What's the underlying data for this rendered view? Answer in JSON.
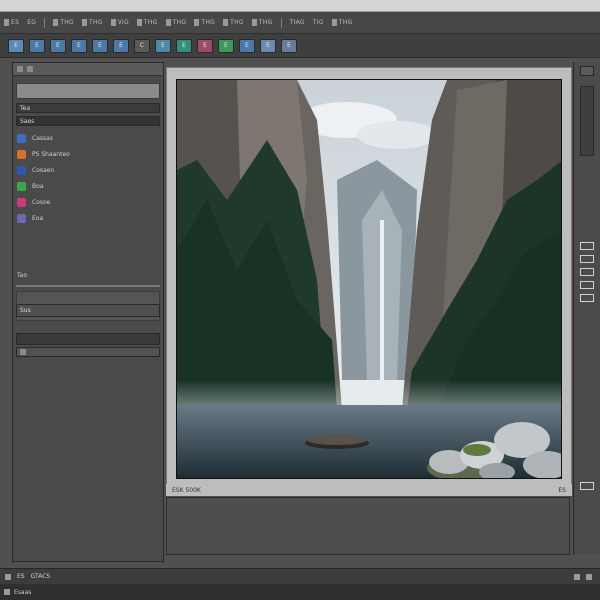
{
  "menu": {
    "items": [
      {
        "label": "ES",
        "icon": "document-icon"
      },
      {
        "label": "EG",
        "icon": "none"
      },
      {
        "label": "THG",
        "icon": "document-icon"
      },
      {
        "label": "THG",
        "icon": "document-icon"
      },
      {
        "label": "ViG",
        "icon": "document-icon"
      },
      {
        "label": "THG",
        "icon": "document-icon"
      },
      {
        "label": "THG",
        "icon": "document-icon"
      },
      {
        "label": "THG",
        "icon": "document-icon"
      },
      {
        "label": "THG",
        "icon": "document-icon"
      },
      {
        "label": "THG",
        "icon": "document-icon"
      },
      {
        "label": "TIAG",
        "icon": "none"
      },
      {
        "label": "TIG",
        "icon": "none"
      },
      {
        "label": "THG",
        "icon": "document-icon"
      }
    ]
  },
  "toolbar": {
    "buttons": [
      {
        "label": "E",
        "color": "#5a8ab8",
        "icon": "file-icon"
      },
      {
        "label": "E",
        "color": "#4c7aa8",
        "icon": "file-icon"
      },
      {
        "label": "E",
        "color": "#4c7aa8",
        "icon": "file-icon"
      },
      {
        "label": "E",
        "color": "#4c7aa8",
        "icon": "file-icon"
      },
      {
        "label": "E",
        "color": "#4c7aa8",
        "icon": "file-icon"
      },
      {
        "label": "E",
        "color": "#4c7aa8",
        "icon": "file-icon"
      },
      {
        "label": "C",
        "color": "#5a5a5a",
        "icon": "refresh-icon"
      },
      {
        "label": "E",
        "color": "#4c8aa8",
        "icon": "file-icon"
      },
      {
        "label": "E",
        "color": "#2e8f7a",
        "icon": "file-icon"
      },
      {
        "label": "E",
        "color": "#a04a6a",
        "icon": "file-icon"
      },
      {
        "label": "E",
        "color": "#3a9a5a",
        "icon": "file-icon"
      },
      {
        "label": "E",
        "color": "#4c7aa8",
        "icon": "file-icon"
      },
      {
        "label": "E",
        "color": "#6a8ab0",
        "icon": "file-icon"
      },
      {
        "label": "E",
        "color": "#6a7a9a",
        "icon": "file-icon"
      }
    ]
  },
  "left_panel": {
    "tab_label": "Tea",
    "bar_label": "Saes",
    "items": [
      {
        "label": "Cassas",
        "color": "#3a6ec8",
        "icon": "layer-icon"
      },
      {
        "label": "PS Shaanteo",
        "color": "#d8702a",
        "icon": "photoshop-icon"
      },
      {
        "label": "Cosaen",
        "color": "#2a5ab0",
        "icon": "layer-icon"
      },
      {
        "label": "Boa",
        "color": "#3aa84a",
        "icon": "leaf-icon"
      },
      {
        "label": "Cosoe",
        "color": "#c83a7a",
        "icon": "brush-icon"
      },
      {
        "label": "Eoa",
        "color": "#6a6ab0",
        "icon": "pen-icon"
      }
    ],
    "sub_label": "Tao",
    "bottom_label": "Sus"
  },
  "canvas": {
    "status_left": "ESK 500K",
    "status_right": "ES"
  },
  "bottom": {
    "label_a": "ES",
    "label_b": "GTACS"
  },
  "status": {
    "label": "Esaas"
  }
}
